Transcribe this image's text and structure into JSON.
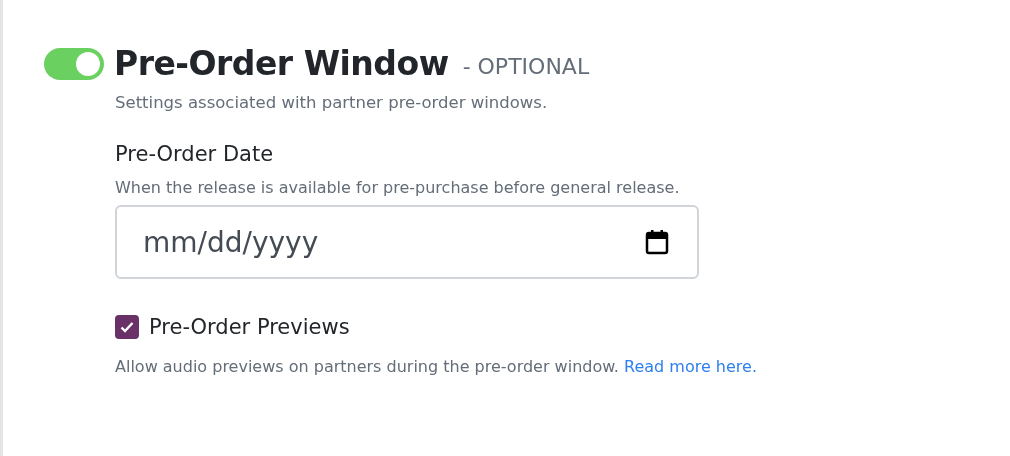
{
  "section": {
    "enabled": true,
    "title": "Pre-Order Window",
    "optional_label": "- OPTIONAL",
    "description": "Settings associated with partner pre-order windows."
  },
  "date_field": {
    "label": "Pre-Order Date",
    "hint": "When the release is available for pre-purchase before general release.",
    "placeholder": "mm/dd/yyyy"
  },
  "previews": {
    "checked": true,
    "label": "Pre-Order Previews",
    "help": "Allow audio previews on partners during the pre-order window.",
    "link": "Read more here."
  }
}
